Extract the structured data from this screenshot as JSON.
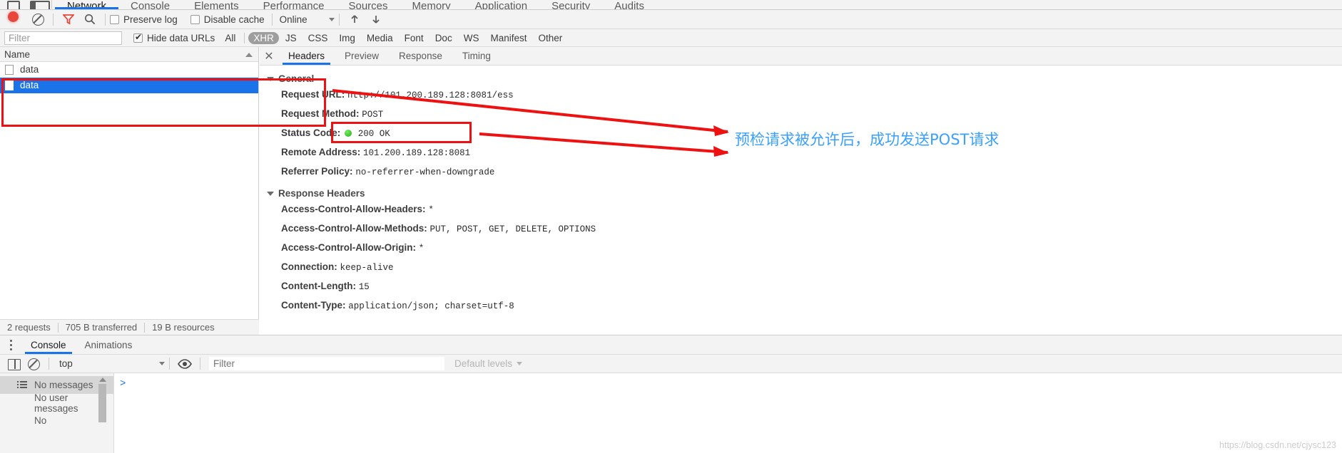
{
  "panel_tabs": [
    {
      "label": "Network",
      "active": true
    },
    {
      "label": "Console",
      "active": false
    },
    {
      "label": "Elements",
      "active": false
    },
    {
      "label": "Performance",
      "active": false
    },
    {
      "label": "Sources",
      "active": false
    },
    {
      "label": "Memory",
      "active": false
    },
    {
      "label": "Application",
      "active": false
    },
    {
      "label": "Security",
      "active": false
    },
    {
      "label": "Audits",
      "active": false
    }
  ],
  "network_toolbar": {
    "record_icon": "record-dot-icon",
    "clear_icon": "clear-icon",
    "filter_icon": "funnel-icon",
    "search_icon": "search-icon",
    "preserve_log_label": "Preserve log",
    "preserve_log_checked": false,
    "disable_cache_label": "Disable cache",
    "disable_cache_checked": false,
    "throttling_value": "Online",
    "import_icon": "upload-arrow-icon",
    "export_icon": "download-arrow-icon"
  },
  "filter_bar": {
    "filter_placeholder": "Filter",
    "filter_value": "",
    "hide_data_urls_label": "Hide data URLs",
    "hide_data_urls_checked": true,
    "types": [
      {
        "label": "All",
        "active": false
      },
      {
        "label": "XHR",
        "active": true
      },
      {
        "label": "JS",
        "active": false
      },
      {
        "label": "CSS",
        "active": false
      },
      {
        "label": "Img",
        "active": false
      },
      {
        "label": "Media",
        "active": false
      },
      {
        "label": "Font",
        "active": false
      },
      {
        "label": "Doc",
        "active": false
      },
      {
        "label": "WS",
        "active": false
      },
      {
        "label": "Manifest",
        "active": false
      },
      {
        "label": "Other",
        "active": false
      }
    ]
  },
  "request_list": {
    "column_header": "Name",
    "rows": [
      {
        "name": "data",
        "selected": false
      },
      {
        "name": "data",
        "selected": true
      }
    ]
  },
  "status_bar": {
    "requests": "2 requests",
    "transferred": "705 B transferred",
    "resources": "19 B resources"
  },
  "details": {
    "close_icon": "close-icon",
    "tabs": [
      {
        "label": "Headers",
        "active": true
      },
      {
        "label": "Preview",
        "active": false
      },
      {
        "label": "Response",
        "active": false
      },
      {
        "label": "Timing",
        "active": false
      }
    ],
    "general": {
      "title": "General",
      "rows": [
        {
          "key": "Request URL:",
          "value": "http://101.200.189.128:8081/ess"
        },
        {
          "key": "Request Method:",
          "value": "POST"
        },
        {
          "key": "Status Code:",
          "value": "200 OK",
          "has_status_dot": true
        },
        {
          "key": "Remote Address:",
          "value": "101.200.189.128:8081"
        },
        {
          "key": "Referrer Policy:",
          "value": "no-referrer-when-downgrade"
        }
      ]
    },
    "response_headers": {
      "title": "Response Headers",
      "rows": [
        {
          "key": "Access-Control-Allow-Headers:",
          "value": "*"
        },
        {
          "key": "Access-Control-Allow-Methods:",
          "value": "PUT, POST, GET, DELETE, OPTIONS"
        },
        {
          "key": "Access-Control-Allow-Origin:",
          "value": "*"
        },
        {
          "key": "Connection:",
          "value": "keep-alive"
        },
        {
          "key": "Content-Length:",
          "value": "15"
        },
        {
          "key": "Content-Type:",
          "value": "application/json; charset=utf-8"
        }
      ]
    }
  },
  "drawer": {
    "menu_icon": "kebab-menu-icon",
    "tabs": [
      {
        "label": "Console",
        "active": true
      },
      {
        "label": "Animations",
        "active": false
      }
    ],
    "console_toolbar": {
      "sidebar_icon": "sidebar-toggle-icon",
      "clear_icon": "clear-icon",
      "context_value": "top",
      "eye_icon": "eye-icon",
      "filter_placeholder": "Filter",
      "filter_value": "",
      "levels_value": "Default levels"
    },
    "sidebar_items": [
      {
        "label": "No messages",
        "icon": "list-icon",
        "selected": true
      },
      {
        "label": "No user messages",
        "icon": "user-icon",
        "selected": false
      },
      {
        "label": "No",
        "icon": "error-icon",
        "selected": false
      }
    ],
    "prompt": ">"
  },
  "annotations": {
    "note_text": "预检请求被允许后，成功发送POST请求",
    "note_color": "#3aa0ff",
    "box_color": "#ee1111"
  },
  "watermark": "https://blog.csdn.net/cjysc123"
}
